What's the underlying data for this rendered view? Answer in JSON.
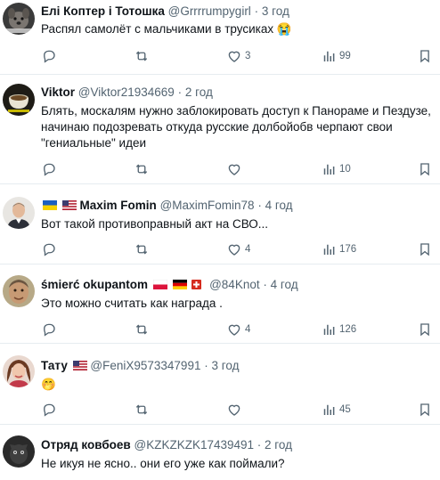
{
  "tweets": [
    {
      "name": "Елі Коптер і Тотошка",
      "handle": "@Grrrrumpygirl",
      "separator": "·",
      "time": "3 год",
      "text_lines": [
        "Распял самолёт с мальчиками в трусиках 😭"
      ],
      "avatar_icon": "dog-avatar-icon",
      "replies": "",
      "retweets": "",
      "likes": "3",
      "views": "99"
    },
    {
      "name": "Viktor",
      "handle": "@Viktor21934669",
      "separator": "·",
      "time": "2 год",
      "text_lines": [
        "Блять, москалям нужно заблокировать доступ к Панораме и Пездузе,",
        "начинаю подозревать откуда русские долбойобв черпают свои",
        "\"гениальные\" идеи"
      ],
      "avatar_icon": "coffee-cup-avatar-icon",
      "replies": "",
      "retweets": "",
      "likes": "",
      "views": "10"
    },
    {
      "name": "Maxim Fomin",
      "handle": "@MaximFomin78",
      "separator": "·",
      "time": "4 год",
      "text_lines": [
        "Вот такой противоправный акт на СВО..."
      ],
      "avatar_icon": "man-portrait-avatar-icon",
      "flags_before": [
        "ukraine-flag-icon",
        "usa-flag-icon"
      ],
      "replies": "",
      "retweets": "",
      "likes": "4",
      "views": "176"
    },
    {
      "name": "śmierć okupantom",
      "handle": "@84Knot",
      "separator": "·",
      "time": "4 год",
      "text_lines": [
        "Это можно считать как награда ."
      ],
      "avatar_icon": "man-face-avatar-icon",
      "flags_after": [
        "poland-flag-icon",
        "germany-flag-icon",
        "switzerland-flag-icon"
      ],
      "replies": "",
      "retweets": "",
      "likes": "4",
      "views": "126"
    },
    {
      "name": "Тату",
      "handle": "@FeniX9573347991",
      "separator": "·",
      "time": "3 год",
      "text_lines": [
        "🤭"
      ],
      "avatar_icon": "woman-portrait-avatar-icon",
      "flags_after": [
        "usa-flag-icon"
      ],
      "replies": "",
      "retweets": "",
      "likes": "",
      "views": "45"
    },
    {
      "name": "Отряд ковбоев",
      "handle": "@KZKZKZK17439491",
      "separator": "·",
      "time": "2 год",
      "text_lines": [
        "Не икуя не ясно.. они его уже как поймали?"
      ],
      "avatar_icon": "dark-creature-avatar-icon",
      "replies": "",
      "retweets": "",
      "likes": "",
      "views": ""
    }
  ],
  "icons": {
    "reply": "reply-icon",
    "retweet": "retweet-icon",
    "like": "heart-icon",
    "views": "views-bar-chart-icon",
    "bookmark": "bookmark-icon"
  },
  "colors": {
    "text": "#0f1419",
    "secondary": "#536471",
    "divider": "#e6ecf0"
  }
}
